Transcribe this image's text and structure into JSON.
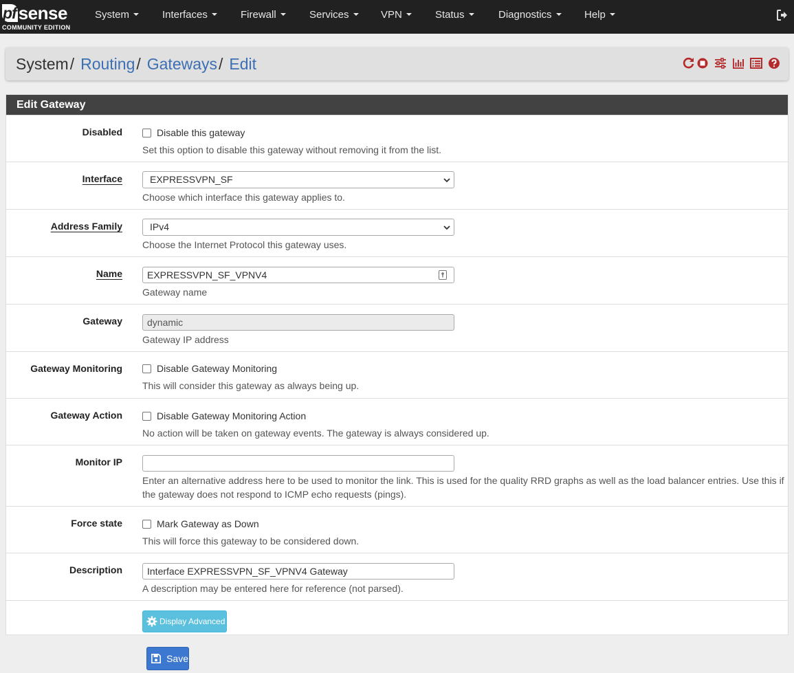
{
  "navbar": {
    "logo_pf": "pf",
    "logo_sense": "sense",
    "logo_edition": "COMMUNITY EDITION",
    "menu": [
      "System",
      "Interfaces",
      "Firewall",
      "Services",
      "VPN",
      "Status",
      "Diagnostics",
      "Help"
    ]
  },
  "breadcrumb": {
    "items": [
      "System",
      "Routing",
      "Gateways",
      "Edit"
    ]
  },
  "panel": {
    "title": "Edit Gateway"
  },
  "form": {
    "disabled": {
      "label": "Disabled",
      "checkbox_text": "Disable this gateway",
      "checked": false,
      "help": "Set this option to disable this gateway without removing it from the list."
    },
    "interface": {
      "label": "Interface",
      "value": "EXPRESSVPN_SF",
      "help": "Choose which interface this gateway applies to."
    },
    "address_family": {
      "label": "Address Family",
      "value": "IPv4",
      "help": "Choose the Internet Protocol this gateway uses."
    },
    "name": {
      "label": "Name",
      "value": "EXPRESSVPN_SF_VPNV4",
      "help": "Gateway name"
    },
    "gateway": {
      "label": "Gateway",
      "value": "dynamic",
      "help": "Gateway IP address"
    },
    "gateway_monitoring": {
      "label": "Gateway Monitoring",
      "checkbox_text": "Disable Gateway Monitoring",
      "checked": false,
      "help": "This will consider this gateway as always being up."
    },
    "gateway_action": {
      "label": "Gateway Action",
      "checkbox_text": "Disable Gateway Monitoring Action",
      "checked": false,
      "help": "No action will be taken on gateway events. The gateway is always considered up."
    },
    "monitor_ip": {
      "label": "Monitor IP",
      "value": "",
      "help_line1": "Enter an alternative address here to be used to monitor the link. This is used for the quality RRD graphs as well as the load balancer entries. Use this if",
      "help_line2": "the gateway does not respond to ICMP echo requests (pings)."
    },
    "force_state": {
      "label": "Force state",
      "checkbox_text": "Mark Gateway as Down",
      "checked": false,
      "help": "This will force this gateway to be considered down."
    },
    "description": {
      "label": "Description",
      "value": "Interface EXPRESSVPN_SF_VPNV4 Gateway",
      "help": "A description may be entered here for reference (not parsed)."
    },
    "advanced_button": "Display Advanced"
  },
  "save_button": "Save",
  "colors": {
    "navbar_bg": "#212121",
    "panel_head_bg": "#424242",
    "link": "#3c6fb4",
    "header_icons": "#b52a2a",
    "advanced_btn": "#5bc0de",
    "save_btn": "#3c77d0"
  },
  "icons": [
    "logout-icon",
    "reload-icon",
    "stop-icon",
    "sliders-icon",
    "chart-icon",
    "log-icon",
    "help-icon",
    "chevron-down-icon",
    "key-icon",
    "gear-icon",
    "save-icon"
  ]
}
